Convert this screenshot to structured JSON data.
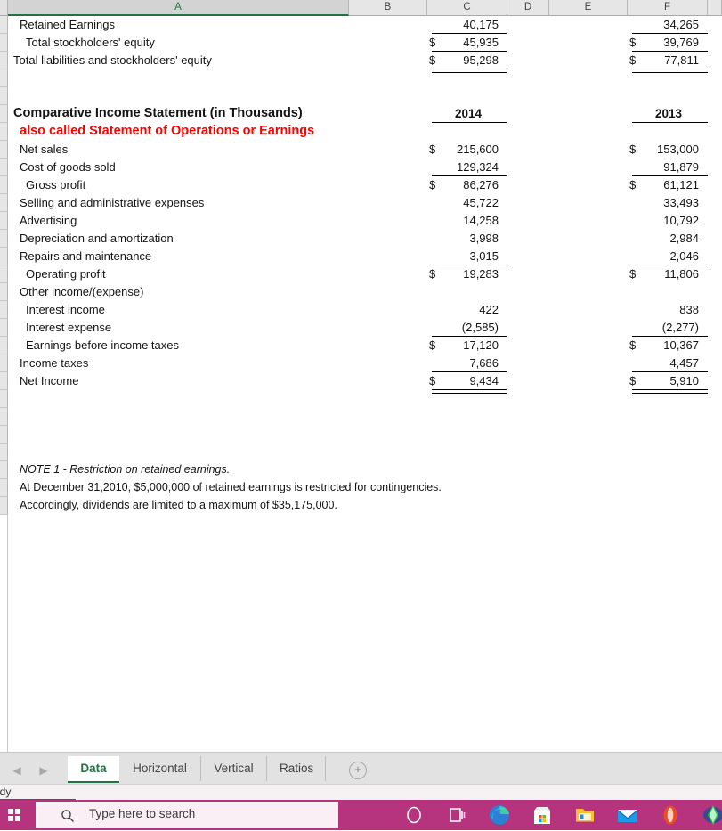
{
  "app": {
    "status_text": "ady",
    "column_headers": [
      "A",
      "B",
      "C",
      "D",
      "E",
      "F"
    ],
    "selected_column": "A"
  },
  "sheet": {
    "rows": [
      {
        "label": "Retained Earnings",
        "indent": 1,
        "c_cur": "",
        "c_val": "40,175",
        "f_cur": "",
        "f_val": "34,265",
        "rule": "single"
      },
      {
        "label": "Total stockholders' equity",
        "indent": 2,
        "c_cur": "$",
        "c_val": "45,935",
        "f_cur": "$",
        "f_val": "39,769",
        "rule": "single"
      },
      {
        "label": "Total liabilities and stockholders' equity",
        "indent": 0,
        "c_cur": "$",
        "c_val": "95,298",
        "f_cur": "$",
        "f_val": "77,811",
        "rule": "double"
      },
      {
        "label": "",
        "indent": 0,
        "c_cur": "",
        "c_val": "",
        "f_cur": "",
        "f_val": "",
        "rule": "none"
      },
      {
        "label": "",
        "indent": 0,
        "c_cur": "",
        "c_val": "",
        "f_cur": "",
        "f_val": "",
        "rule": "none"
      },
      {
        "label": "Comparative Income Statement (in Thousands)",
        "indent": 0,
        "style": "title",
        "c_header": "2014",
        "f_header": "2013",
        "rule": "single"
      },
      {
        "label": "also called Statement of Operations or Earnings",
        "indent": 1,
        "style": "red",
        "c_cur": "",
        "c_val": "",
        "f_cur": "",
        "f_val": "",
        "rule": "none"
      },
      {
        "label": "Net sales",
        "indent": 1,
        "c_cur": "$",
        "c_val": "215,600",
        "f_cur": "$",
        "f_val": "153,000",
        "rule": "none"
      },
      {
        "label": "Cost of goods sold",
        "indent": 1,
        "c_cur": "",
        "c_val": "129,324",
        "f_cur": "",
        "f_val": "91,879",
        "rule": "single"
      },
      {
        "label": "Gross profit",
        "indent": 2,
        "c_cur": "$",
        "c_val": "86,276",
        "f_cur": "$",
        "f_val": "61,121",
        "rule": "none"
      },
      {
        "label": "Selling and administrative expenses",
        "indent": 1,
        "c_cur": "",
        "c_val": "45,722",
        "f_cur": "",
        "f_val": "33,493",
        "rule": "none"
      },
      {
        "label": "Advertising",
        "indent": 1,
        "c_cur": "",
        "c_val": "14,258",
        "f_cur": "",
        "f_val": "10,792",
        "rule": "none"
      },
      {
        "label": "Depreciation and amortization",
        "indent": 1,
        "c_cur": "",
        "c_val": "3,998",
        "f_cur": "",
        "f_val": "2,984",
        "rule": "none"
      },
      {
        "label": "Repairs and maintenance",
        "indent": 1,
        "c_cur": "",
        "c_val": "3,015",
        "f_cur": "",
        "f_val": "2,046",
        "rule": "single"
      },
      {
        "label": "Operating profit",
        "indent": 2,
        "c_cur": "$",
        "c_val": "19,283",
        "f_cur": "$",
        "f_val": "11,806",
        "rule": "none"
      },
      {
        "label": "Other income/(expense)",
        "indent": 1,
        "c_cur": "",
        "c_val": "",
        "f_cur": "",
        "f_val": "",
        "rule": "none"
      },
      {
        "label": "Interest income",
        "indent": 2,
        "c_cur": "",
        "c_val": "422",
        "f_cur": "",
        "f_val": "838",
        "rule": "none"
      },
      {
        "label": "Interest expense",
        "indent": 2,
        "c_cur": "",
        "c_val": "(2,585)",
        "f_cur": "",
        "f_val": "(2,277)",
        "rule": "single"
      },
      {
        "label": "Earnings before income taxes",
        "indent": 2,
        "c_cur": "$",
        "c_val": "17,120",
        "f_cur": "$",
        "f_val": "10,367",
        "rule": "none"
      },
      {
        "label": "Income taxes",
        "indent": 1,
        "c_cur": "",
        "c_val": "7,686",
        "f_cur": "",
        "f_val": "4,457",
        "rule": "single"
      },
      {
        "label": "Net Income",
        "indent": 1,
        "c_cur": "$",
        "c_val": "9,434",
        "f_cur": "$",
        "f_val": "5,910",
        "rule": "double"
      },
      {
        "label": "",
        "indent": 0,
        "c_cur": "",
        "c_val": "",
        "f_cur": "",
        "f_val": "",
        "rule": "none"
      },
      {
        "label": "",
        "indent": 0,
        "c_cur": "",
        "c_val": "",
        "f_cur": "",
        "f_val": "",
        "rule": "none"
      },
      {
        "label": "",
        "indent": 0,
        "c_cur": "",
        "c_val": "",
        "f_cur": "",
        "f_val": "",
        "rule": "none"
      },
      {
        "label": "",
        "indent": 0,
        "c_cur": "",
        "c_val": "",
        "f_cur": "",
        "f_val": "",
        "rule": "none"
      },
      {
        "label": "NOTE 1 - Restriction on retained earnings.",
        "indent": 1,
        "style": "ital",
        "c_cur": "",
        "c_val": "",
        "f_cur": "",
        "f_val": "",
        "rule": "none"
      },
      {
        "label": "At December 31,2010, $5,000,000 of retained earnings is restricted for contingencies.",
        "indent": 1,
        "style": "note",
        "c_cur": "",
        "c_val": "",
        "f_cur": "",
        "f_val": "",
        "rule": "none"
      },
      {
        "label": "Accordingly, dividends are limited to a maximum of $35,175,000.",
        "indent": 1,
        "style": "note",
        "c_cur": "",
        "c_val": "",
        "f_cur": "",
        "f_val": "",
        "rule": "none"
      }
    ]
  },
  "tabbar": {
    "prev_arrow": "◀",
    "next_arrow": "▶",
    "add_sheet": "+",
    "tabs": [
      {
        "label": "Data",
        "active": true
      },
      {
        "label": "Horizontal",
        "active": false
      },
      {
        "label": "Vertical",
        "active": false
      },
      {
        "label": "Ratios",
        "active": false
      }
    ]
  },
  "taskbar": {
    "search_placeholder": "Type here to search",
    "accent_color": "#b5347d",
    "icons": [
      "cortana-icon",
      "task-view-icon",
      "edge-icon",
      "microsoft-store-icon",
      "file-explorer-icon",
      "mail-icon",
      "opera-icon",
      "sims-icon",
      "chrome-icon"
    ]
  }
}
